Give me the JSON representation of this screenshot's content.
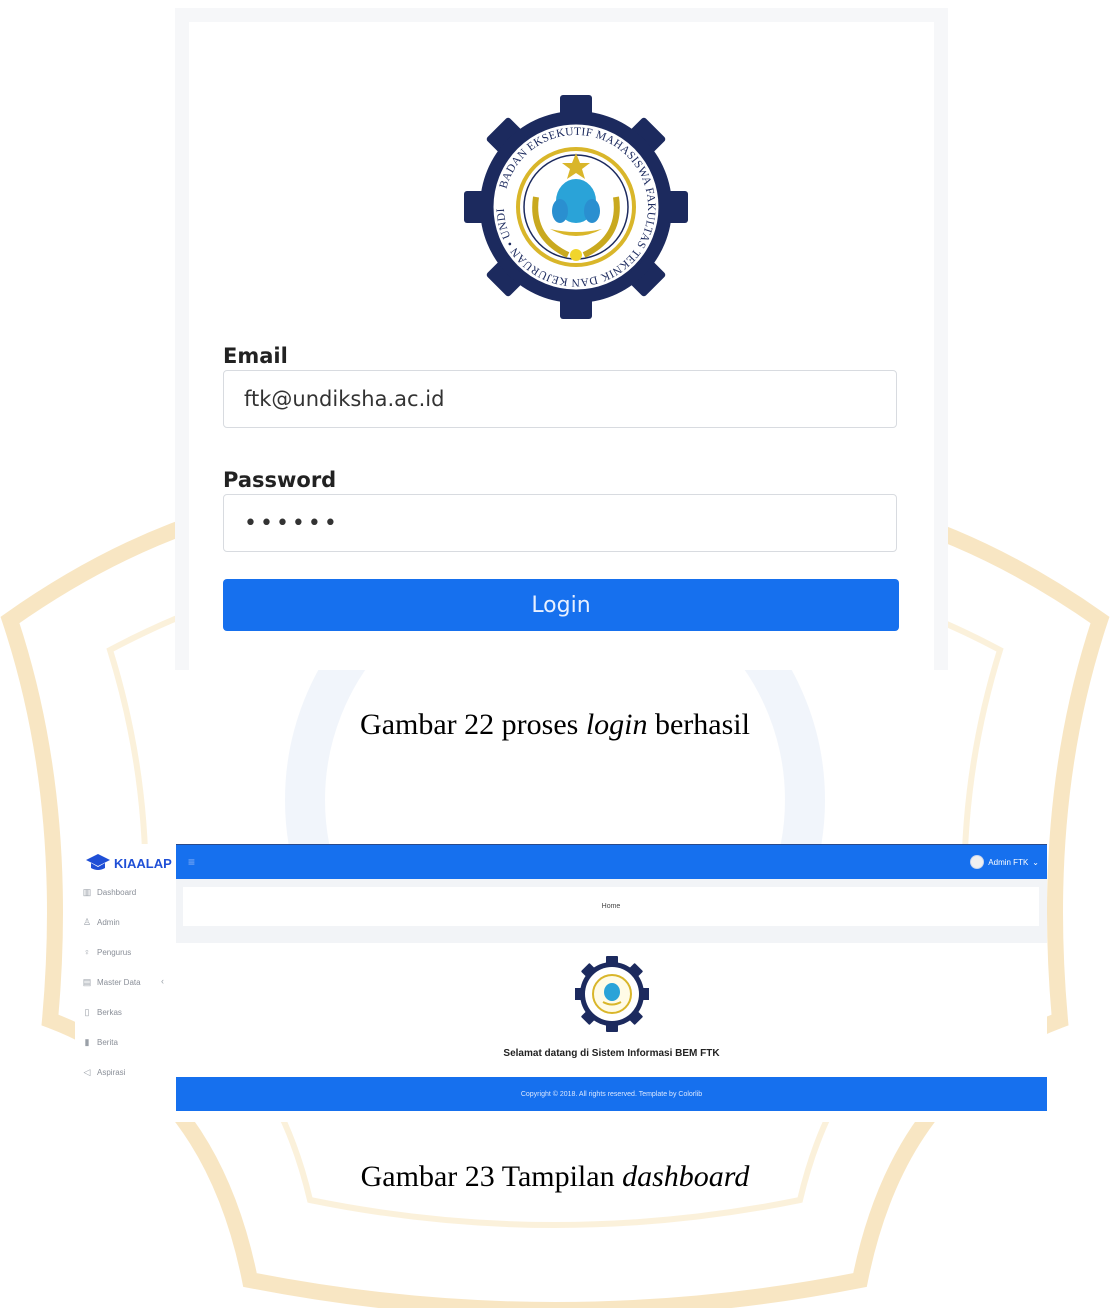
{
  "figure22": {
    "login_form": {
      "email_label": "Email",
      "email_value": "ftk@undiksha.ac.id",
      "password_label": "Password",
      "password_value": "••••••",
      "login_button": "Login"
    },
    "logo_text": "BADAN EKSEKUTIF MAHASISWA FAKULTAS TEKNIK DAN KEJURUAN • UNDIKSHA •",
    "caption_prefix": "Gambar 22 proses ",
    "caption_italic": "login",
    "caption_suffix": " berhasil"
  },
  "figure23": {
    "dashboard": {
      "brand": "KIAALAP",
      "sidebar_items": [
        "Dashboard",
        "Admin",
        "Pengurus",
        "Master Data",
        "Berkas",
        "Berita",
        "Aspirasi"
      ],
      "user_name": "Admin FTK",
      "breadcrumb": "Home",
      "welcome_text": "Selamat datang di Sistem Informasi BEM FTK",
      "footer_text": "Copyright © 2018. All rights reserved. Template by Colorlib"
    },
    "caption_prefix": "Gambar 23 Tampilan ",
    "caption_italic": "dashboard"
  },
  "colors": {
    "primary_blue": "#1670ee",
    "brand_blue": "#1f4fd6",
    "watermark_gold": "#e9b44c",
    "logo_navy": "#1c2a5e",
    "logo_gold": "#d9b62a"
  }
}
